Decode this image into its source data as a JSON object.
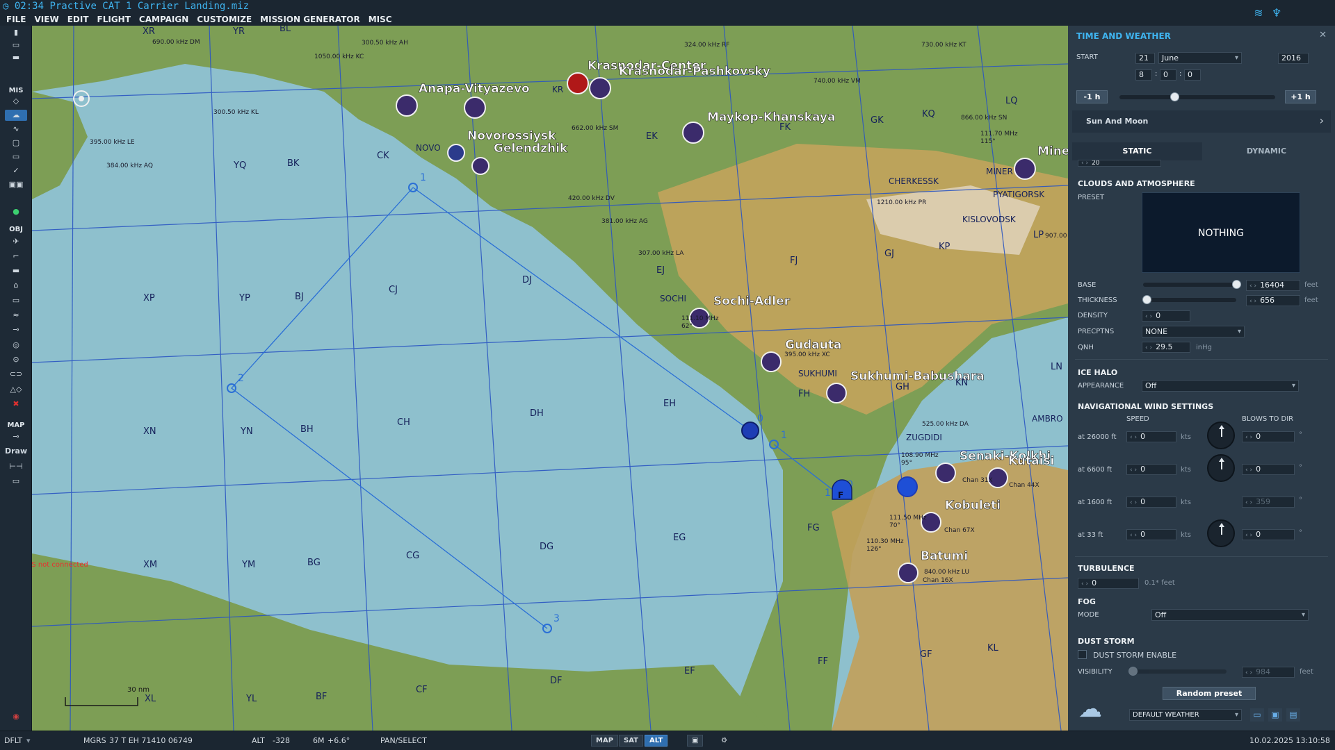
{
  "window": {
    "title": "02:34 Practive CAT 1 Carrier Landing.miz"
  },
  "menu": [
    "FILE",
    "VIEW",
    "EDIT",
    "FLIGHT",
    "CAMPAIGN",
    "CUSTOMIZE",
    "MISSION GENERATOR",
    "MISC"
  ],
  "toolbar": {
    "sections": [
      "MIS",
      "OBJ",
      "MAP"
    ],
    "draw_label": "Draw"
  },
  "map": {
    "gps_warning": "SRS not connected",
    "scale_label": "30 nm",
    "colors": {
      "sea": "#8ec0cd",
      "land": "#7a9b55",
      "route": "#2a6fd6"
    },
    "grid_labels": [
      "XR",
      "YR",
      "BL",
      "YQ",
      "BK",
      "CK",
      "XP",
      "YP",
      "BJ",
      "CJ",
      "DJ",
      "EJ",
      "FJ",
      "GJ",
      "KP",
      "XN",
      "YN",
      "BH",
      "CH",
      "DH",
      "EH",
      "FH",
      "GH",
      "KN",
      "XM",
      "YM",
      "BG",
      "CG",
      "DG",
      "EG",
      "FG",
      "XL",
      "YL",
      "BF",
      "CF",
      "DF",
      "EF",
      "FF",
      "GF",
      "KL",
      "LQ",
      "KQ",
      "GK",
      "FK",
      "EK",
      "LP",
      "LN",
      "NOVO",
      "SOCHI",
      "SUKHUMI",
      "ZUGDIDI",
      "MINER",
      "PYATIGORSK",
      "KISLOVODSK",
      "CHERKESSK",
      "AMBRO",
      "KR"
    ],
    "airfields": [
      "Anapa-Vityazevo",
      "Krasnodar-Center",
      "Krasnodar-Pashkovsky",
      "Novorossiysk",
      "Gelendzhik",
      "Maykop-Khanskaya",
      "Sochi-Adler",
      "Gudauta",
      "Sukhumi-Babushara",
      "Senaki-Kolkhi",
      "Kutaisi",
      "Kobuleti",
      "Batumi",
      "Mine"
    ],
    "navaids": [
      "690.00 kHz DM",
      "1050.00 kHz KC",
      "300.50 kHz AH",
      "324.00 kHz RF",
      "730.00 kHz KT",
      "740.00 kHz VM",
      "866.00 kHz SN",
      "300.50 kHz KL",
      "395.00 kHz LE",
      "384.00 kHz AQ",
      "662.00 kHz SM",
      "420.00 kHz DV",
      "381.00 kHz AG",
      "307.00 kHz LA",
      "1210.00 kHz PR",
      "907.00",
      "395.00 kHz XC",
      "525.00 kHz DA",
      "111.10 MHz",
      "62°",
      "108.90 MHz",
      "95°",
      "111.50 MHz",
      "70°",
      "110.30 MHz",
      "126°",
      "111.70 MHz",
      "115°",
      "Chan 67X",
      "Chan 16X",
      "Chan 44X",
      "Chan 31X",
      "840.00 kHz LU"
    ],
    "waypoints": [
      "1",
      "2",
      "3",
      "0",
      "1",
      "0",
      "1"
    ],
    "unit_markers": [
      "F"
    ]
  },
  "status": {
    "profile": "DFLT",
    "coords_label": "MGRS",
    "coords": "37 T EH 71410 06749",
    "alt_label": "ALT",
    "alt_value": "-328",
    "magvar_label": "6M",
    "magvar_value": "+6.6°",
    "mode": "PAN/SELECT",
    "buttons": [
      "MAP",
      "SAT",
      "ALT"
    ],
    "datetime": "10.02.2025 13:10:58"
  },
  "panel": {
    "title": "TIME AND WEATHER",
    "start_label": "START",
    "day": "21",
    "month": "June",
    "year": "2016",
    "hour": "8",
    "minute": "0",
    "second": "0",
    "minus_hour": "-1 h",
    "plus_hour": "+1 h",
    "sun_moon": "Sun And Moon",
    "tabs": [
      "STATIC",
      "DYNAMIC"
    ],
    "partial_value": "20",
    "clouds_header": "CLOUDS AND ATMOSPHERE",
    "preset_label": "PRESET",
    "preset_value": "NOTHING",
    "base_label": "BASE",
    "base_value": "16404",
    "thickness_label": "THICKNESS",
    "thickness_value": "656",
    "feet": "feet",
    "density_label": "DENSITY",
    "density_value": "0",
    "precip_label": "PRECPTNS",
    "precip_value": "NONE",
    "qnh_label": "QNH",
    "qnh_value": "29.5",
    "qnh_unit": "inHg",
    "ice_header": "ICE HALO",
    "appearance_label": "APPEARANCE",
    "appearance_value": "Off",
    "wind_header": "NAVIGATIONAL WIND SETTINGS",
    "speed_label": "SPEED",
    "blows_label": "BLOWS TO DIR",
    "kts": "kts",
    "deg": "°",
    "winds": [
      {
        "alt": "at 26000 ft",
        "speed": "0",
        "dir": "0"
      },
      {
        "alt": "at 6600 ft",
        "speed": "0",
        "dir": "0"
      },
      {
        "alt": "at 1600 ft",
        "speed": "0",
        "dir": "359"
      },
      {
        "alt": "at 33 ft",
        "speed": "0",
        "dir": "0"
      }
    ],
    "turbulence_header": "TURBULENCE",
    "turbulence_value": "0",
    "turbulence_unit": "0.1* feet",
    "fog_header": "FOG",
    "fog_mode_label": "MODE",
    "fog_mode_value": "Off",
    "dust_header": "DUST STORM",
    "dust_enable_label": "DUST STORM ENABLE",
    "visibility_label": "VISIBILITY",
    "visibility_value": "984",
    "random_preset": "Random preset",
    "weather_select": "DEFAULT WEATHER"
  }
}
